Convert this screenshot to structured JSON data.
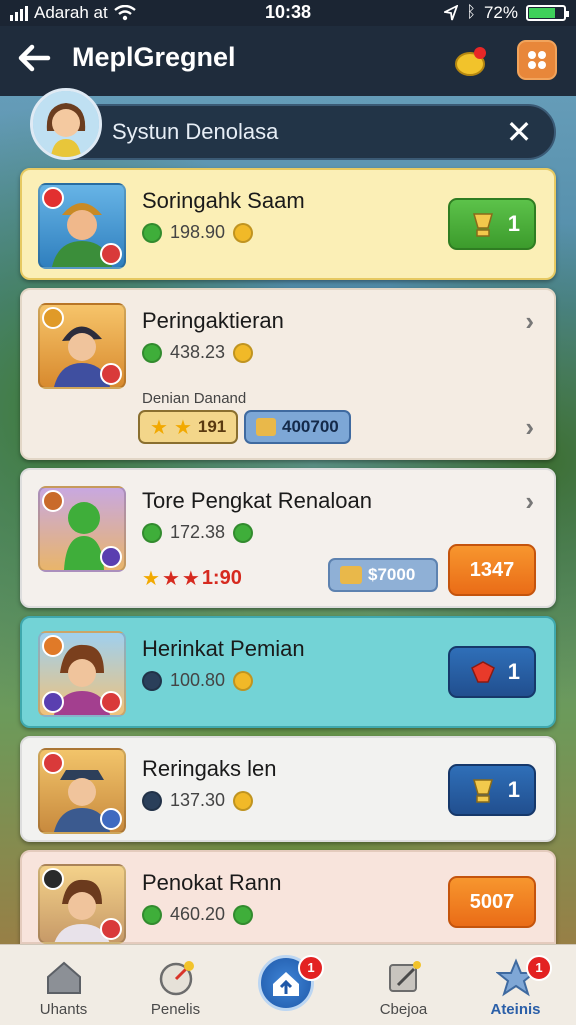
{
  "status": {
    "carrier": "Adarah at",
    "time": "10:38",
    "battery": "72%"
  },
  "header": {
    "title": "MeplGregnel"
  },
  "search": {
    "text": "Systun Denolasa"
  },
  "cards": [
    {
      "name": "Soringahk Saam",
      "score": "198.90",
      "sub": "",
      "button": "1",
      "button_style": "green"
    },
    {
      "name": "Peringaktieran",
      "score": "438.23",
      "sub": "Denian Danand",
      "pill1": "191",
      "pill2": "400700"
    },
    {
      "name": "Tore Pengkat Renaloan",
      "score": "172.38",
      "stars_value": "1:90",
      "pill2": "$7000",
      "button": "1347",
      "button_style": "orange"
    },
    {
      "name": "Herinkat Pemian",
      "score": "100.80",
      "button": "1",
      "button_style": "blue"
    },
    {
      "name": "Reringaks len",
      "score": "137.30",
      "button": "1",
      "button_style": "blue"
    },
    {
      "name": "Penokat Rann",
      "score": "460.20",
      "button": "5007",
      "button_style": "orange"
    }
  ],
  "nav": [
    {
      "label": "Uhants",
      "icon": "home-icon"
    },
    {
      "label": "Penelis",
      "icon": "gauge-icon"
    },
    {
      "label": "",
      "icon": "home-up-icon",
      "badge": "1"
    },
    {
      "label": "Cbejoa",
      "icon": "edit-icon"
    },
    {
      "label": "Ateinis",
      "icon": "star-icon",
      "badge": "1"
    }
  ],
  "colors": {
    "header": "#1f2c3c",
    "accent": "#2f6fb8",
    "highlight_card": "#fbefb6",
    "teal_card": "#73d3d6"
  }
}
